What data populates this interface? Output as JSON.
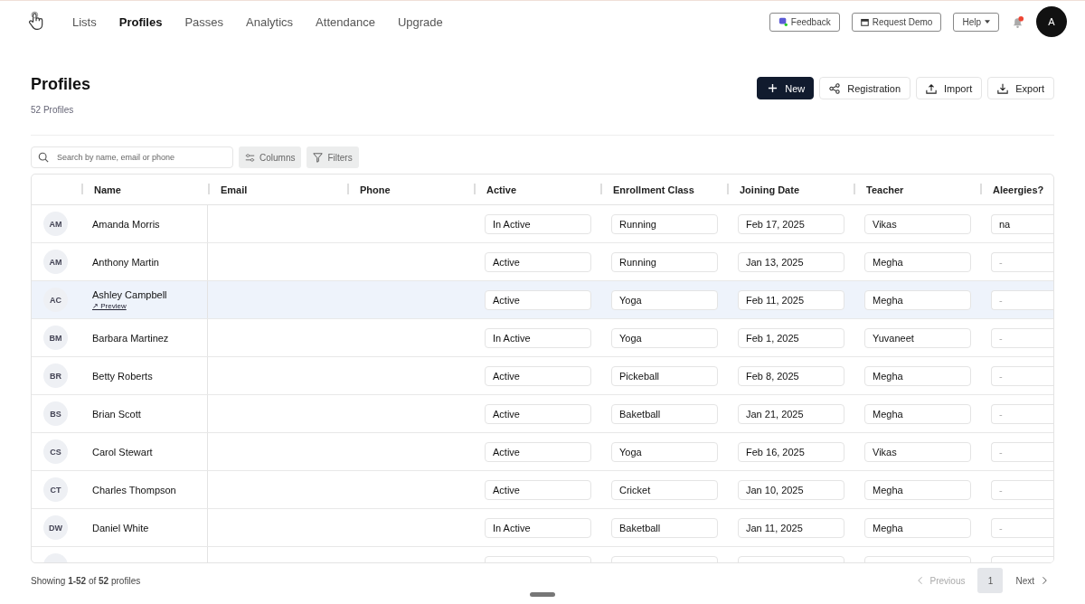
{
  "nav": {
    "items": [
      {
        "label": "Lists",
        "selected": false
      },
      {
        "label": "Profiles",
        "selected": true
      },
      {
        "label": "Passes",
        "selected": false
      },
      {
        "label": "Analytics",
        "selected": false
      },
      {
        "label": "Attendance",
        "selected": false
      },
      {
        "label": "Upgrade",
        "selected": false
      }
    ],
    "buttons": [
      {
        "label": "Feedback",
        "kind": "feedback"
      },
      {
        "label": "Request Demo",
        "kind": "calendar"
      },
      {
        "label": "Help",
        "kind": "menu"
      }
    ],
    "notifications": {
      "unread": true
    },
    "avatar": "A"
  },
  "page": {
    "title": "Profiles",
    "count": "52 Profiles",
    "actions": [
      {
        "label": "New",
        "kind": "primary"
      },
      {
        "label": "Registration",
        "kind": "share"
      },
      {
        "label": "Import",
        "kind": "upload"
      },
      {
        "label": "Export",
        "kind": "download"
      }
    ]
  },
  "toolbar": {
    "search": {
      "placeholder": "Search by name, email or phone"
    },
    "buttons": [
      {
        "label": "Columns",
        "kind": "columns"
      },
      {
        "label": "Filters",
        "kind": "filter"
      }
    ]
  },
  "table": {
    "columns": [
      "Name",
      "Email",
      "Phone",
      "Active",
      "Enrollment Class",
      "Joining Date",
      "Teacher",
      "Aleergies?"
    ],
    "rows": [
      {
        "initials": "AM",
        "name": "Amanda Morris",
        "selected": false,
        "active": "In Active",
        "class": "Running",
        "date": "Feb 17, 2025",
        "teacher": "Vikas",
        "allergies": {
          "value": "na"
        }
      },
      {
        "initials": "AM",
        "name": "Anthony Martin",
        "selected": false,
        "active": "Active",
        "class": "Running",
        "date": "Jan 13, 2025",
        "teacher": "Megha",
        "allergies": {
          "placeholder": "-"
        }
      },
      {
        "initials": "AC",
        "name": "Ashley Campbell",
        "selected": true,
        "link": "↗ Preview",
        "active": "Active",
        "class": "Yoga",
        "date": "Feb 11, 2025",
        "teacher": "Megha",
        "allergies": {
          "placeholder": "-"
        }
      },
      {
        "initials": "BM",
        "name": "Barbara Martinez",
        "selected": false,
        "active": "In Active",
        "class": "Yoga",
        "date": "Feb 1, 2025",
        "teacher": "Yuvaneet",
        "allergies": {
          "placeholder": "-"
        }
      },
      {
        "initials": "BR",
        "name": "Betty Roberts",
        "selected": false,
        "active": "Active",
        "class": "Pickeball",
        "date": "Feb 8, 2025",
        "teacher": "Megha",
        "allergies": {
          "placeholder": "-"
        }
      },
      {
        "initials": "BS",
        "name": "Brian Scott",
        "selected": false,
        "active": "Active",
        "class": "Baketball",
        "date": "Jan 21, 2025",
        "teacher": "Megha",
        "allergies": {
          "placeholder": "-"
        }
      },
      {
        "initials": "CS",
        "name": "Carol Stewart",
        "selected": false,
        "active": "Active",
        "class": "Yoga",
        "date": "Feb 16, 2025",
        "teacher": "Vikas",
        "allergies": {
          "placeholder": "-"
        }
      },
      {
        "initials": "CT",
        "name": "Charles Thompson",
        "selected": false,
        "active": "Active",
        "class": "Cricket",
        "date": "Jan 10, 2025",
        "teacher": "Megha",
        "allergies": {
          "placeholder": "-"
        }
      },
      {
        "initials": "DW",
        "name": "Daniel White",
        "selected": false,
        "active": "In Active",
        "class": "Baketball",
        "date": "Jan 11, 2025",
        "teacher": "Megha",
        "allergies": {
          "placeholder": "-"
        }
      },
      {
        "initials": "",
        "name": "",
        "selected": false,
        "active": "",
        "class": "",
        "date": "",
        "teacher": "",
        "allergies": {}
      }
    ]
  },
  "footer": {
    "summary": "Showing **1-52** of **52** profiles",
    "pagination": {
      "previous": {
        "label": "Previous",
        "disabled": true
      },
      "pages": [
        {
          "label": "1",
          "selected": true
        }
      ],
      "next": {
        "label": "Next",
        "disabled": false
      }
    }
  }
}
